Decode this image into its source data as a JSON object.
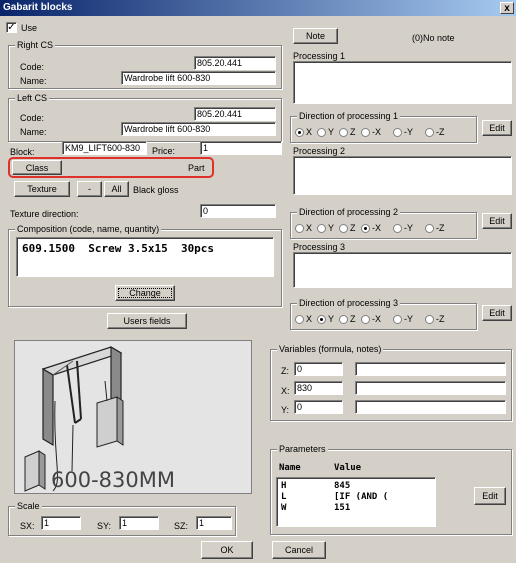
{
  "window": {
    "title": "Gabarit blocks",
    "close": "x"
  },
  "use": {
    "label": "Use",
    "checked": true
  },
  "right_cs": {
    "title": "Right CS",
    "code_label": "Code:",
    "code": "805.20.441",
    "name_label": "Name:",
    "name": "Wardrobe lift 600-830"
  },
  "left_cs": {
    "title": "Left CS",
    "code_label": "Code:",
    "code": "805.20.441",
    "name_label": "Name:",
    "name": "Wardrobe lift 600-830"
  },
  "block": {
    "label": "Block:",
    "value": "KM9_LIFT600-830",
    "price_label": "Price:",
    "price": "1"
  },
  "class_row": {
    "class_button": "Class",
    "part": "Part"
  },
  "texture": {
    "button": "Texture",
    "minus": "-",
    "all": "All",
    "value": "Black gloss"
  },
  "texture_direction": {
    "label": "Texture direction:",
    "value": "0"
  },
  "composition": {
    "title": "Composition (code, name, quantity)",
    "line": "609.1500  Screw 3.5x15  30pcs",
    "change_button": "Change"
  },
  "users_fields_button": "Users fields",
  "preview": {
    "caption": "600-830MM"
  },
  "scale": {
    "title": "Scale",
    "sx_label": "SX:",
    "sx": "1",
    "sy_label": "SY:",
    "sy": "1",
    "sz_label": "SZ:",
    "sz": "1"
  },
  "note": {
    "button": "Note",
    "status": "(0)No note"
  },
  "processing": [
    {
      "label": "Processing 1",
      "direction_title": "Direction of processing 1",
      "selected": "X"
    },
    {
      "label": "Processing 2",
      "direction_title": "Direction of processing 2",
      "selected": "-X"
    },
    {
      "label": "Processing 3",
      "direction_title": "Direction of processing 3",
      "selected": "Y"
    }
  ],
  "direction_options": [
    "X",
    "Y",
    "Z",
    "-X",
    "-Y",
    "-Z"
  ],
  "edit_label": "Edit",
  "variables": {
    "title": "Variables (formula, notes)",
    "rows": [
      {
        "label": "Z:",
        "value": "0",
        "note": ""
      },
      {
        "label": "X:",
        "value": "830",
        "note": ""
      },
      {
        "label": "Y:",
        "value": "0",
        "note": ""
      }
    ]
  },
  "parameters": {
    "title": "Parameters",
    "col_name": "Name",
    "col_value": "Value",
    "rows": [
      {
        "name": "H",
        "value": "845"
      },
      {
        "name": "L",
        "value": "[IF (AND ("
      },
      {
        "name": "W",
        "value": "151"
      }
    ],
    "edit": "Edit"
  },
  "footer": {
    "ok": "OK",
    "cancel": "Cancel"
  },
  "colors": {
    "titlebar": "#0a246a",
    "highlight": "#e0302a",
    "window": "#d4d0c8"
  }
}
